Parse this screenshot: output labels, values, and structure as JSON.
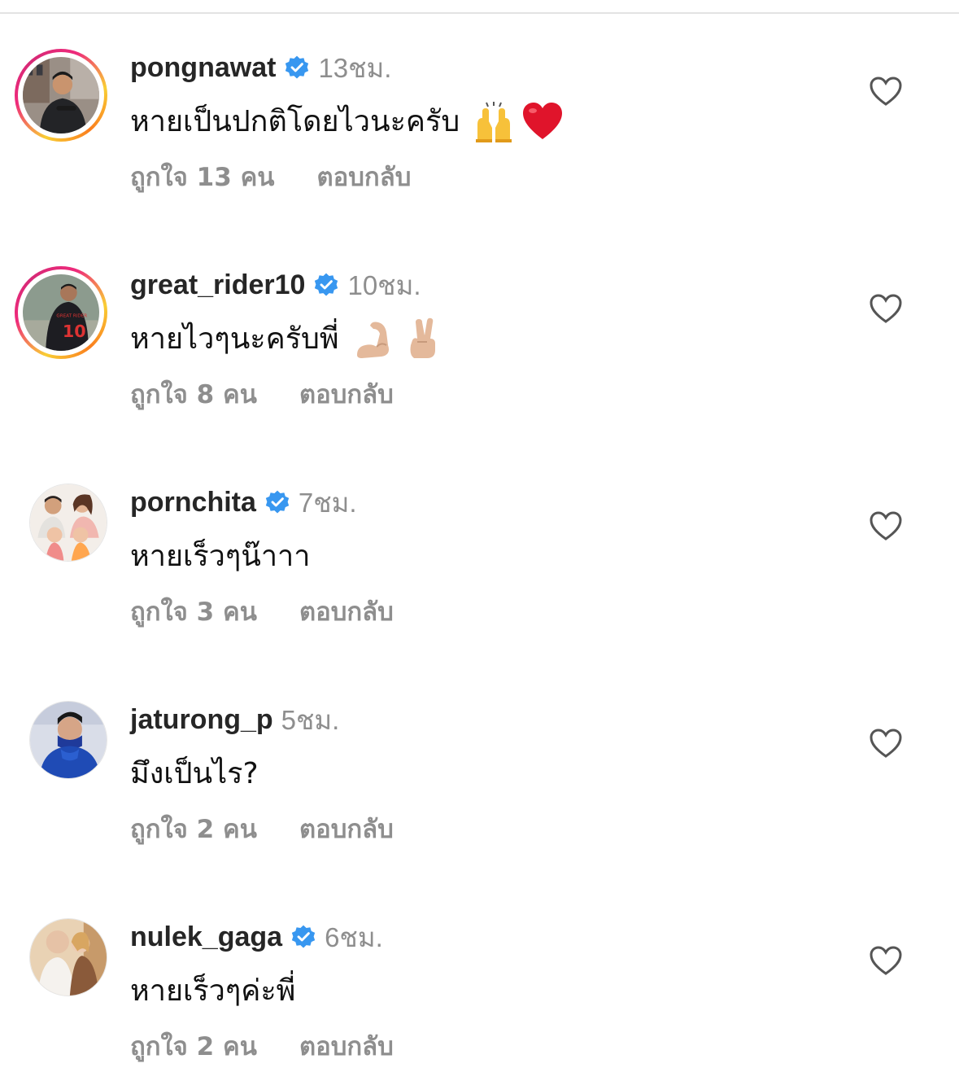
{
  "colors": {
    "username": "#262626",
    "secondary": "#8e8e8e",
    "verified": "#3897f0",
    "text": "#111111"
  },
  "comments": [
    {
      "username": "pongnawat",
      "verified": true,
      "time": "13ชม.",
      "text": "หายเป็นปกติโดยไวนะครับ",
      "emojis": [
        "raised-hands-icon",
        "red-heart-icon"
      ],
      "likes": "ถูกใจ 13 คน",
      "reply": "ตอบกลับ",
      "story_ring": true
    },
    {
      "username": "great_rider10",
      "verified": true,
      "time": "10ชม.",
      "text": "หายไวๆนะครับพี่",
      "emojis": [
        "flexed-biceps-icon",
        "victory-hand-icon"
      ],
      "likes": "ถูกใจ 8 คน",
      "reply": "ตอบกลับ",
      "story_ring": true
    },
    {
      "username": "pornchita",
      "verified": true,
      "time": "7ชม.",
      "text": "หายเร็วๆน๊าาา",
      "emojis": [],
      "likes": "ถูกใจ 3 คน",
      "reply": "ตอบกลับ",
      "story_ring": false
    },
    {
      "username": "jaturong_p",
      "verified": false,
      "time": "5ชม.",
      "text": "มึงเป็นไร?",
      "emojis": [],
      "likes": "ถูกใจ 2 คน",
      "reply": "ตอบกลับ",
      "story_ring": false
    },
    {
      "username": "nulek_gaga",
      "verified": true,
      "time": "6ชม.",
      "text": "หายเร็วๆค่ะพี่",
      "emojis": [],
      "likes": "ถูกใจ 2 คน",
      "reply": "ตอบกลับ",
      "story_ring": false
    }
  ]
}
